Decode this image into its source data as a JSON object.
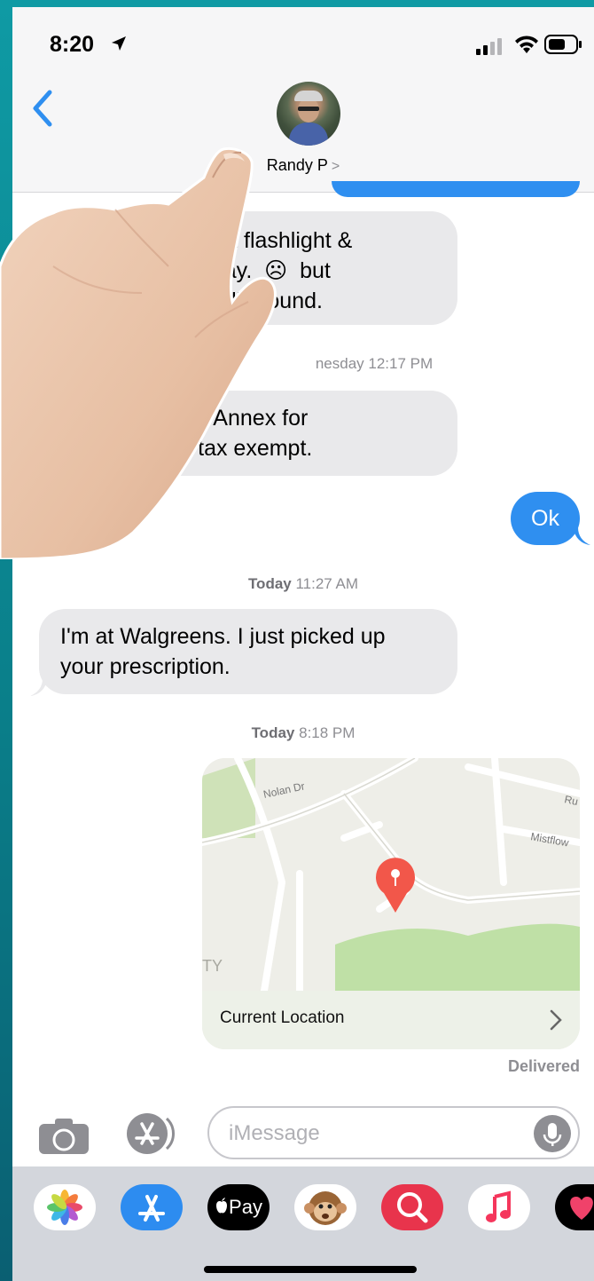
{
  "status": {
    "time": "8:20"
  },
  "contact": {
    "name": "Randy P",
    "chevron": ">"
  },
  "messages": [
    {
      "dir": "in",
      "lines": [
        "I w          s   with a flashlight &",
        "             y run away.  ☹  but",
        "           the    re still around."
      ]
    },
    {
      "dir": "stamp",
      "label": "",
      "time": "nesday 12:17 PM"
    },
    {
      "dir": "in",
      "lines": [
        "          at Postal Annex for",
        "         NPSOT tax exempt."
      ]
    },
    {
      "dir": "out",
      "text": "Ok"
    },
    {
      "dir": "stamp",
      "label": "Today",
      "time": "11:27 AM"
    },
    {
      "dir": "in",
      "lines": [
        "I'm at Walgreens. I just picked up",
        "your prescription."
      ]
    },
    {
      "dir": "stamp",
      "label": "Today",
      "time": "8:18 PM"
    }
  ],
  "map": {
    "streets": [
      "Nolan Dr",
      "Mistflow",
      "Ru",
      "TY"
    ],
    "footer": "Current Location",
    "chevron": "›"
  },
  "delivered": "Delivered",
  "input": {
    "placeholder": "iMessage"
  },
  "apps": [
    "photos-app",
    "app-store-app",
    "apple-pay-app",
    "animoji-app",
    "web-search-app",
    "music-app",
    "digital-touch-app"
  ],
  "apple_pay_label": "Pay",
  "colors": {
    "accent": "#2f8ff0",
    "incoming": "#e9e9eb",
    "background": "#0b8a96"
  }
}
